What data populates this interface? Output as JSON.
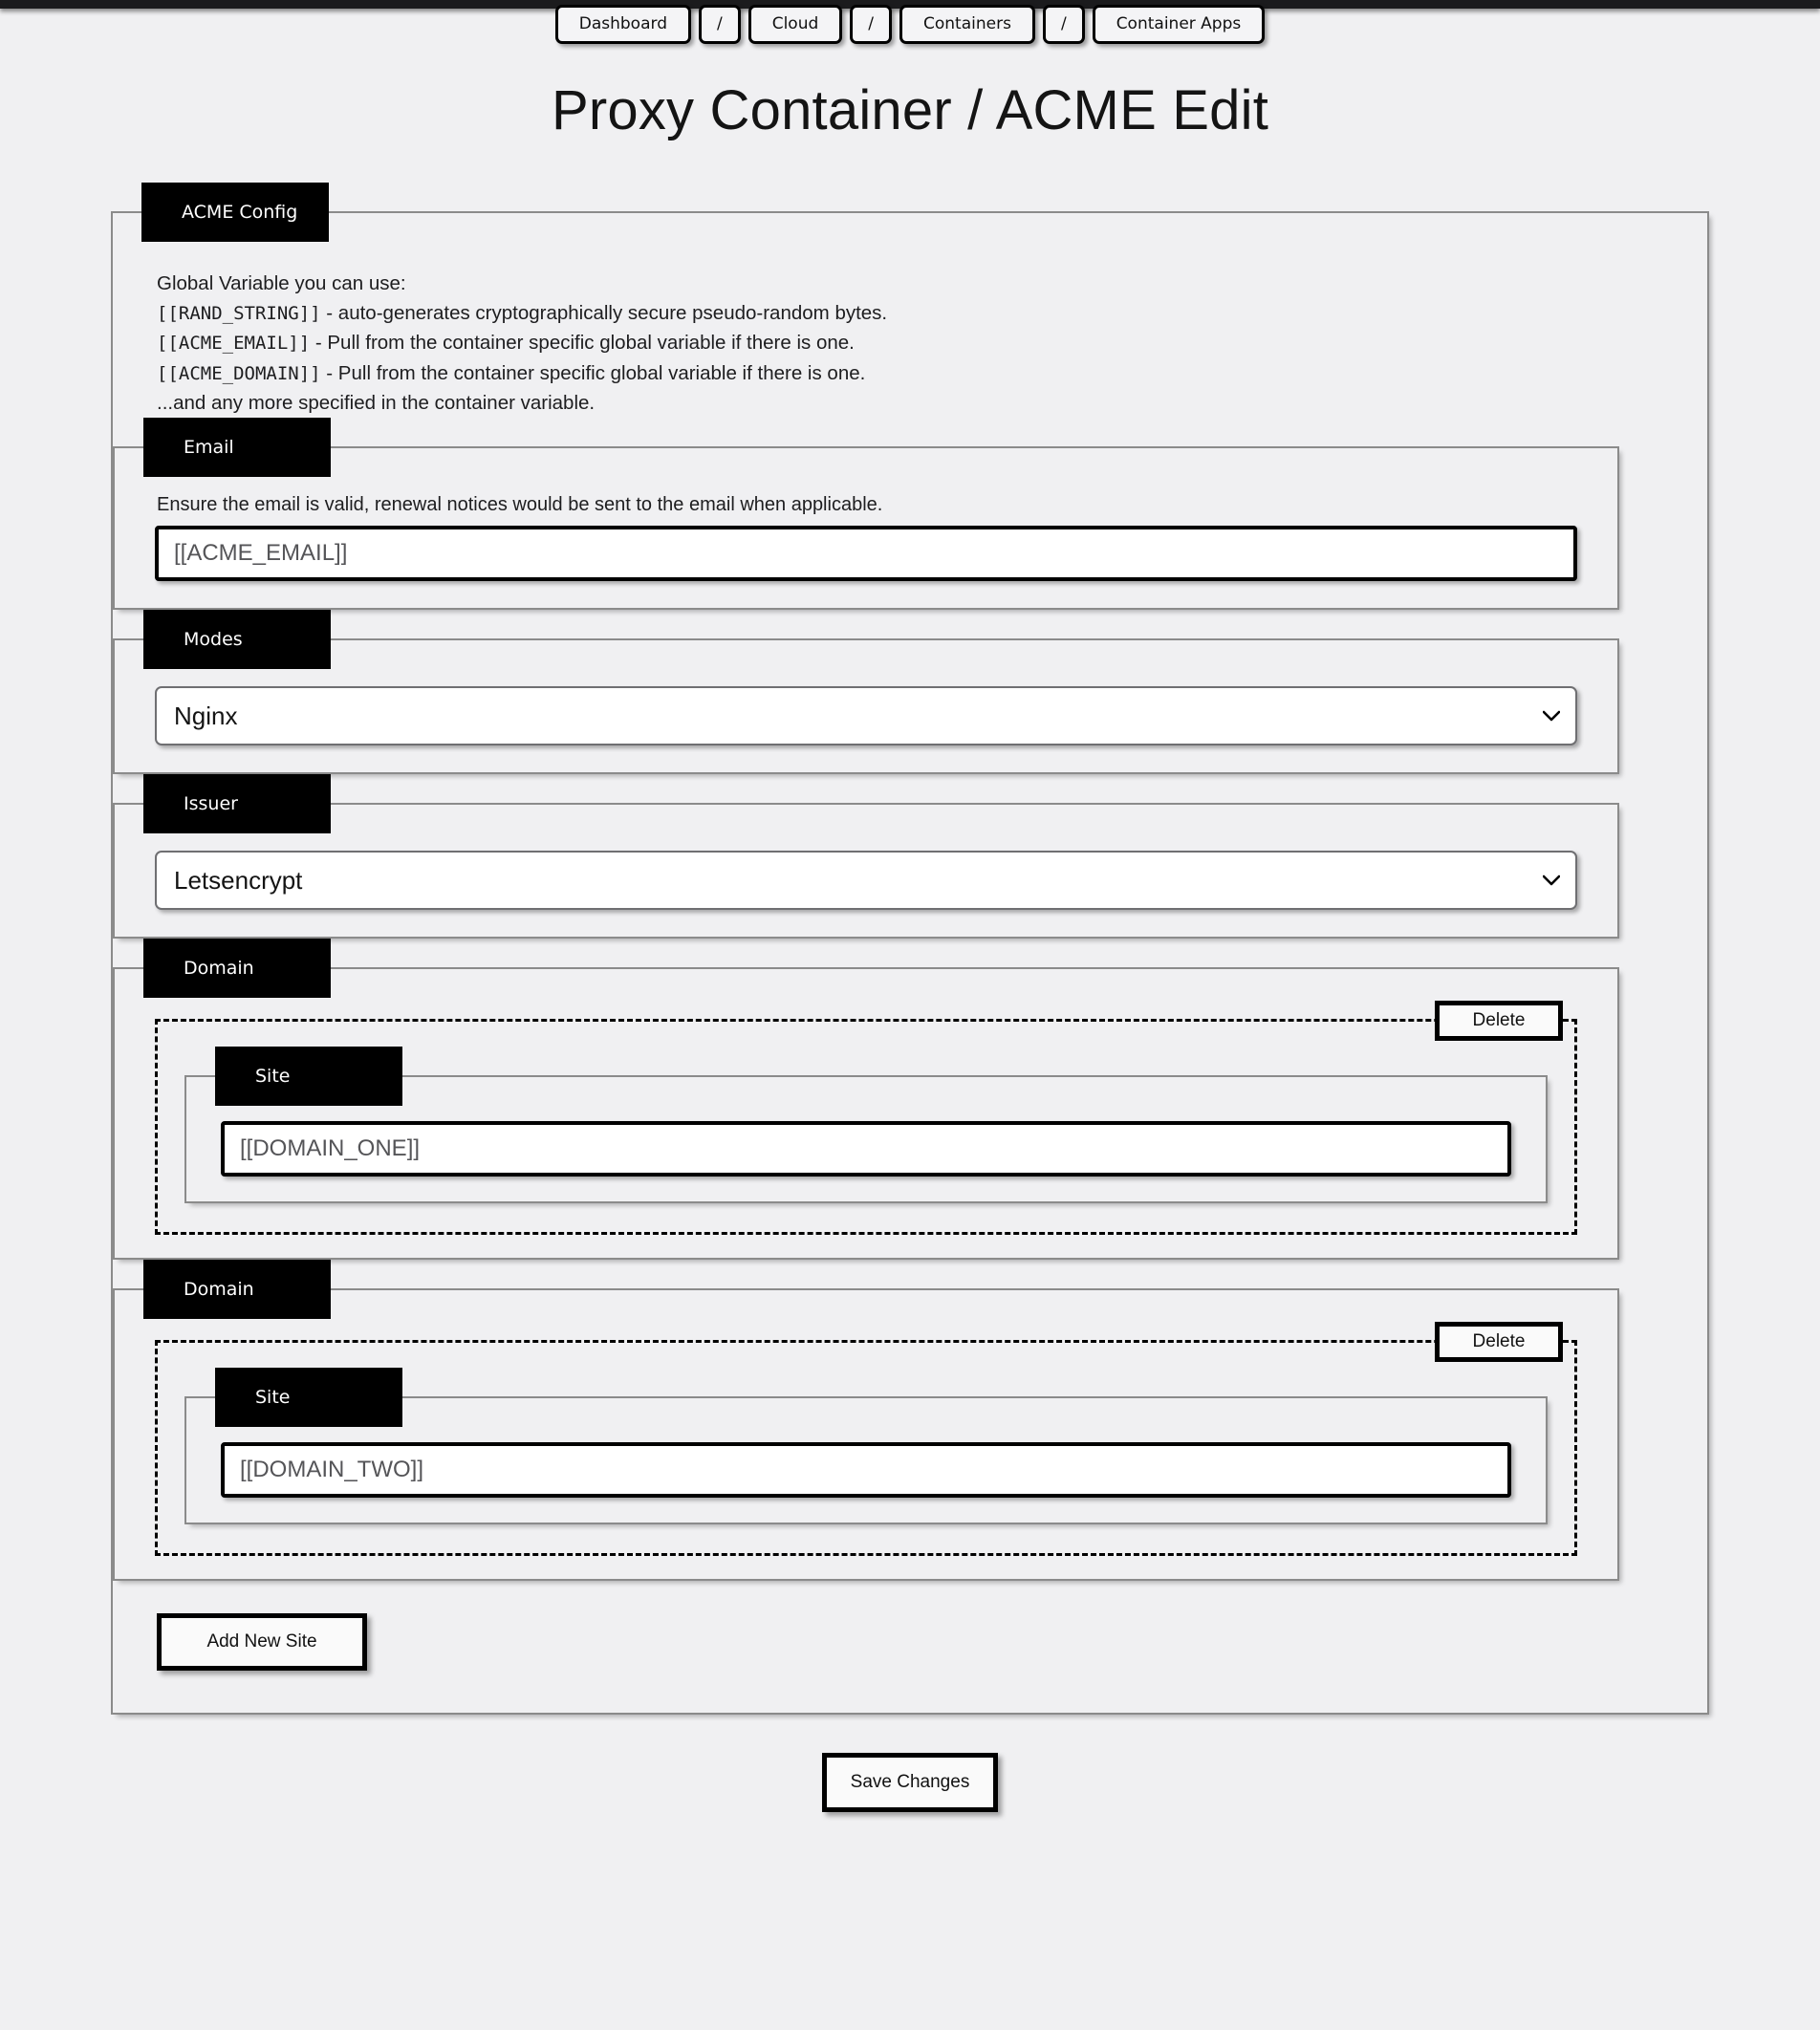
{
  "breadcrumb": {
    "items": [
      {
        "label": "Dashboard",
        "sep": false
      },
      {
        "label": "/",
        "sep": true
      },
      {
        "label": "Cloud",
        "sep": false
      },
      {
        "label": "/",
        "sep": true
      },
      {
        "label": "Containers",
        "sep": false
      },
      {
        "label": "/",
        "sep": true
      },
      {
        "label": "Container Apps",
        "sep": false
      }
    ]
  },
  "page": {
    "title": "Proxy Container / ACME Edit"
  },
  "config": {
    "legend": "ACME Config",
    "vars_intro": "Global Variable you can use:",
    "vars": [
      {
        "token": "[[RAND_STRING]]",
        "desc": " - auto-generates cryptographically secure pseudo-random bytes."
      },
      {
        "token": "[[ACME_EMAIL]]",
        "desc": " - Pull from the container specific global variable if there is one."
      },
      {
        "token": "[[ACME_DOMAIN]]",
        "desc": " - Pull from the container specific global variable if there is one."
      }
    ],
    "vars_outro": "...and any more specified in the container variable."
  },
  "email": {
    "legend": "Email",
    "hint": "Ensure the email is valid, renewal notices would be sent to the email when applicable.",
    "value": "[[ACME_EMAIL]]",
    "placeholder": "[[ACME_EMAIL]]"
  },
  "modes": {
    "legend": "Modes",
    "selected": "Nginx",
    "options": [
      "Nginx"
    ]
  },
  "issuer": {
    "legend": "Issuer",
    "selected": "Letsencrypt",
    "options": [
      "Letsencrypt"
    ]
  },
  "domains": [
    {
      "legend": "Domain",
      "delete_label": "Delete",
      "site_legend": "Site",
      "value": "[[DOMAIN_ONE]]",
      "placeholder": "[[DOMAIN_ONE]]"
    },
    {
      "legend": "Domain",
      "delete_label": "Delete",
      "site_legend": "Site",
      "value": "[[DOMAIN_TWO]]",
      "placeholder": "[[DOMAIN_TWO]]"
    }
  ],
  "actions": {
    "add_new_site": "Add New Site",
    "save_changes": "Save Changes"
  },
  "icons": {
    "chevron_down": "chevron-down-icon"
  },
  "colors": {
    "page_background": "#f0f0f2",
    "legend_background": "#000000",
    "legend_text": "#ffffff",
    "input_border": "#000000",
    "fieldset_border": "#8b8b8b",
    "topbar": "#1b1b1d"
  }
}
